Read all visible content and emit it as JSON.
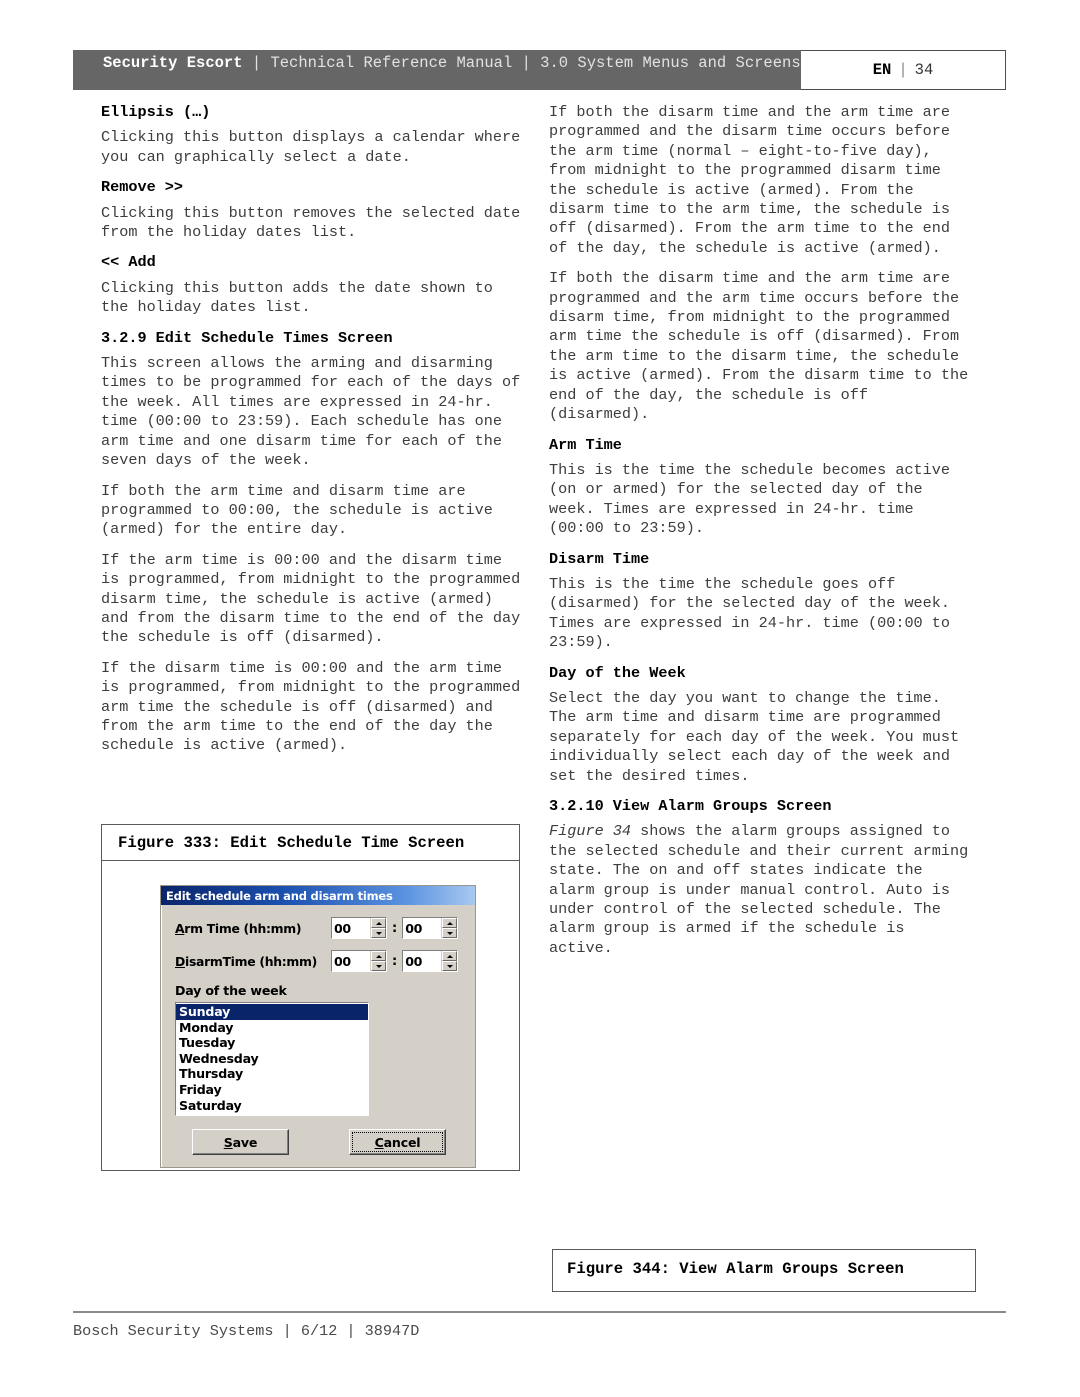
{
  "header": {
    "brand": "Security Escort",
    "separator": " | ",
    "rest": "Technical Reference Manual | 3.0  System Menus and Screens",
    "lang": "EN",
    "page_sep": "|",
    "page_number": "34"
  },
  "left_column": {
    "blocks": [
      {
        "type": "heading",
        "text": "Ellipsis (…)"
      },
      {
        "type": "para",
        "text": "Clicking this button displays a calendar where you can graphically select a date."
      },
      {
        "type": "heading",
        "text": "Remove >>"
      },
      {
        "type": "para",
        "text": "Clicking this button removes the selected date from the holiday dates list."
      },
      {
        "type": "heading",
        "text": "<< Add"
      },
      {
        "type": "para",
        "text": "Clicking this button adds the date shown to the holiday dates list."
      },
      {
        "type": "heading",
        "text": "3.2.9 Edit Schedule Times Screen"
      },
      {
        "type": "para",
        "text": "This screen allows the arming and disarming times to be programmed for each of the days of the week. All times are expressed in 24-hr. time (00:00 to 23:59). Each schedule has one arm time and one disarm time for each of the seven days of the week."
      },
      {
        "type": "para",
        "text": "If both the arm time and disarm time are programmed to 00:00, the schedule is active (armed) for the entire day."
      },
      {
        "type": "para",
        "text": "If the arm time is 00:00 and the disarm time is programmed, from midnight to the programmed disarm time, the schedule is active (armed) and from the disarm time to the end of the day the schedule is off (disarmed)."
      },
      {
        "type": "para",
        "text": "If the disarm time is 00:00 and the arm time is programmed, from midnight to the programmed arm time the schedule is off (disarmed) and from the arm time to the end of the day the schedule is active (armed)."
      }
    ]
  },
  "right_column": {
    "blocks": [
      {
        "type": "para",
        "text": "If both the disarm time and the arm time are programmed and the disarm time occurs before the arm time (normal – eight-to-five day), from midnight to the programmed disarm time the schedule is active (armed). From the disarm time to the arm time, the schedule is off (disarmed). From the arm time to the end of the day, the schedule is active (armed)."
      },
      {
        "type": "para",
        "text": "If both the disarm time and the arm time are programmed and the arm time occurs before the disarm time, from midnight to the programmed arm time the schedule is off (disarmed). From the arm time to the disarm time, the schedule is active (armed). From the disarm time to the end of the day, the schedule is off (disarmed)."
      },
      {
        "type": "heading",
        "text": "Arm Time"
      },
      {
        "type": "para",
        "text": "This is the time the schedule becomes active (on or armed) for the selected day of the week. Times are expressed in 24-hr. time (00:00 to 23:59)."
      },
      {
        "type": "heading",
        "text": "Disarm Time"
      },
      {
        "type": "para",
        "text": "This is the time the schedule goes off (disarmed) for the selected day of the week. Times are expressed in 24-hr. time (00:00 to 23:59)."
      },
      {
        "type": "heading",
        "text": "Day of the Week"
      },
      {
        "type": "para",
        "text": "Select the day you want to change the time. The arm time and disarm time are programmed separately for each day of the week. You must individually select each day of the week and set the desired times."
      },
      {
        "type": "heading",
        "text": "3.2.10 View Alarm Groups Screen"
      },
      {
        "type": "para_italic_lead",
        "italic": "Figure 34",
        "text": " shows the alarm groups assigned to the selected schedule and their current arming state. The on and off states indicate the alarm group is under manual control. Auto is under control of the selected schedule. The alarm group is armed if the schedule is active."
      }
    ]
  },
  "figure_left": {
    "caption": "Figure 333: Edit Schedule Time Screen",
    "dialog": {
      "title": "Edit schedule arm and disarm times",
      "arm_label_underline": "A",
      "arm_label_rest": "rm Time (hh:mm)",
      "arm_hours": "00",
      "arm_minutes": "00",
      "time_separator": ":",
      "disarm_label_underline": "D",
      "disarm_label_rest": "isarmTime (hh:mm)",
      "disarm_hours": "00",
      "disarm_minutes": "00",
      "day_group_label": "Day of the week",
      "days": [
        "Sunday",
        "Monday",
        "Tuesday",
        "Wednesday",
        "Thursday",
        "Friday",
        "Saturday"
      ],
      "selected_day": "Sunday",
      "save_underline": "S",
      "save_rest": "ave",
      "cancel_underline": "C",
      "cancel_rest": "ancel",
      "titlebar_color_start": "#0a246a",
      "titlebar_color_end": "#a8c8f0",
      "selection_color": "#0a246a",
      "face_color": "#d4d0c8"
    }
  },
  "figure_right": {
    "caption": "Figure 344: View Alarm Groups Screen"
  },
  "footer": {
    "text": "Bosch Security Systems | 6/12 | 38947D"
  }
}
